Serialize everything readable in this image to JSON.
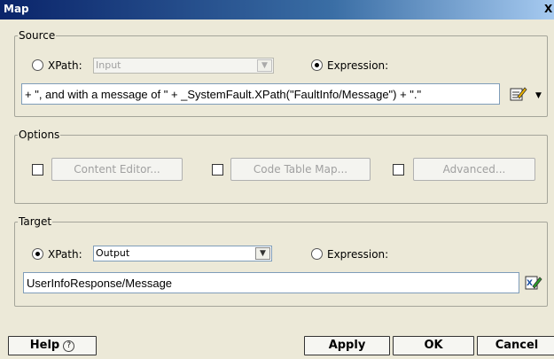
{
  "window": {
    "title": "Map",
    "close_label": "X"
  },
  "source": {
    "legend": "Source",
    "xpath_label": "XPath:",
    "xpath_value": "Input",
    "expression_label": "Expression:",
    "mode": "expression",
    "expression_text": "+ \", and with a message of \" + _SystemFault.XPath(\"FaultInfo/Message\") + \".\"",
    "editor_icon": "pencil-edit-icon",
    "dropdown_icon": "chevron-down-icon"
  },
  "options": {
    "legend": "Options",
    "content_editor_label": "Content Editor...",
    "code_table_map_label": "Code Table Map...",
    "advanced_label": "Advanced..."
  },
  "target": {
    "legend": "Target",
    "xpath_label": "XPath:",
    "xpath_value": "Output",
    "expression_label": "Expression:",
    "mode": "xpath",
    "target_text": "UserInfoResponse/Message",
    "xpath_editor_icon": "xpath-editor-icon"
  },
  "buttons": {
    "help_label": "Help",
    "help_icon": "?",
    "apply_label": "Apply",
    "ok_label": "OK",
    "cancel_label": "Cancel"
  }
}
